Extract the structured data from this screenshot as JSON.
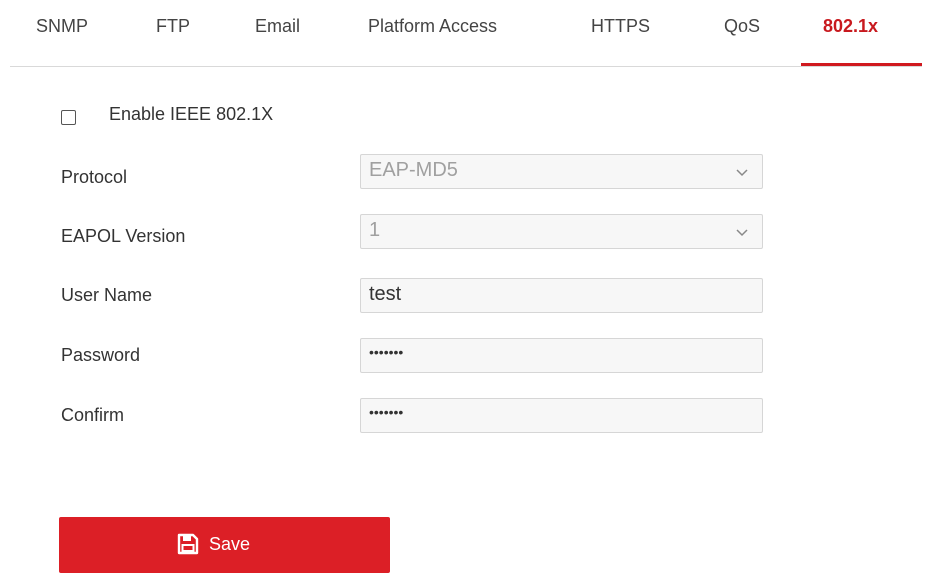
{
  "tabs": [
    {
      "label": "SNMP"
    },
    {
      "label": "FTP"
    },
    {
      "label": "Email"
    },
    {
      "label": "Platform Access"
    },
    {
      "label": "HTTPS"
    },
    {
      "label": "QoS"
    },
    {
      "label": "802.1x",
      "active": true
    }
  ],
  "form": {
    "enable_label": "Enable IEEE 802.1X",
    "enable_checked": false,
    "protocol": {
      "label": "Protocol",
      "value": "EAP-MD5"
    },
    "eapol": {
      "label": "EAPOL Version",
      "value": "1"
    },
    "username": {
      "label": "User Name",
      "value": "test"
    },
    "password": {
      "label": "Password",
      "value": "•••••••"
    },
    "confirm": {
      "label": "Confirm",
      "value": "•••••••"
    }
  },
  "actions": {
    "save_label": "Save"
  },
  "colors": {
    "accent": "#dc1f26",
    "active_tab": "#c8191e"
  },
  "icons": {
    "save": "floppy-disk-icon",
    "dropdown": "chevron-down-icon"
  }
}
